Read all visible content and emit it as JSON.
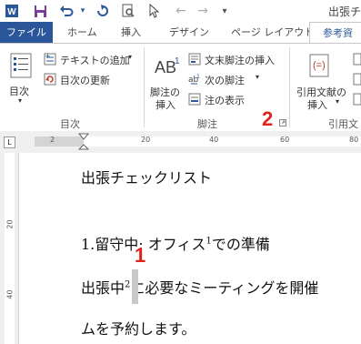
{
  "window": {
    "title": "出張チ"
  },
  "tabs": [
    {
      "label": "ファイル"
    },
    {
      "label": "ホーム"
    },
    {
      "label": "挿入"
    },
    {
      "label": "デザイン"
    },
    {
      "label": "ページ レイアウト"
    },
    {
      "label": "参考資"
    }
  ],
  "ribbon": {
    "toc": {
      "button": "目次",
      "add_text": "テキストの追加",
      "update": "目次の更新",
      "group": "目次"
    },
    "footnotes": {
      "insert_line1": "脚注の",
      "insert_line2": "挿入",
      "endnote": "文末脚注の挿入",
      "next": "次の脚注",
      "show": "注の表示",
      "group": "脚注",
      "ab_glyph": "AB",
      "ab_sup": "1"
    },
    "citations": {
      "insert_line1": "引用文献の",
      "insert_line2": "挿入",
      "group": "引用文"
    }
  },
  "ruler": {
    "numbers": [
      "2",
      "20",
      "40",
      "60",
      "80"
    ]
  },
  "vruler": {
    "numbers": [
      "20",
      "40"
    ]
  },
  "document": {
    "title": "出張チェックリスト",
    "item1_main": "1.留守中: オフィス",
    "item1_sup": "1",
    "item1_tail": "での準備",
    "body_a": "出張中",
    "body_sup": "2",
    "body_b": "に必要なミーティングを開催",
    "body_2": "ムを予約します。"
  },
  "annotations": {
    "marker1": "1",
    "marker2": "2"
  },
  "colors": {
    "accent": "#2b579a",
    "marker": "#e2231a"
  }
}
